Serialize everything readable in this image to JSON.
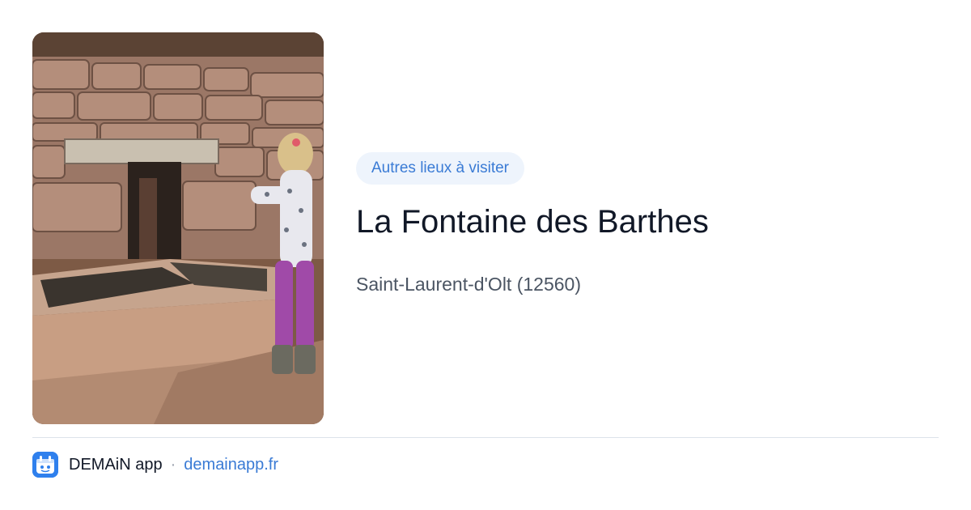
{
  "tag": {
    "label": "Autres lieux à visiter"
  },
  "place": {
    "title": "La Fontaine des Barthes",
    "location": "Saint-Laurent-d'Olt (12560)"
  },
  "footer": {
    "app_name": "DEMAiN app",
    "separator": "·",
    "domain": "demainapp.fr",
    "icon": "app-logo-icon"
  },
  "colors": {
    "accent": "#3a7bd5",
    "tag_background": "#eef4fc",
    "title": "#111827",
    "subtitle": "#4b5563",
    "divider": "#dde3ea",
    "app_icon": "#2f80ed"
  }
}
